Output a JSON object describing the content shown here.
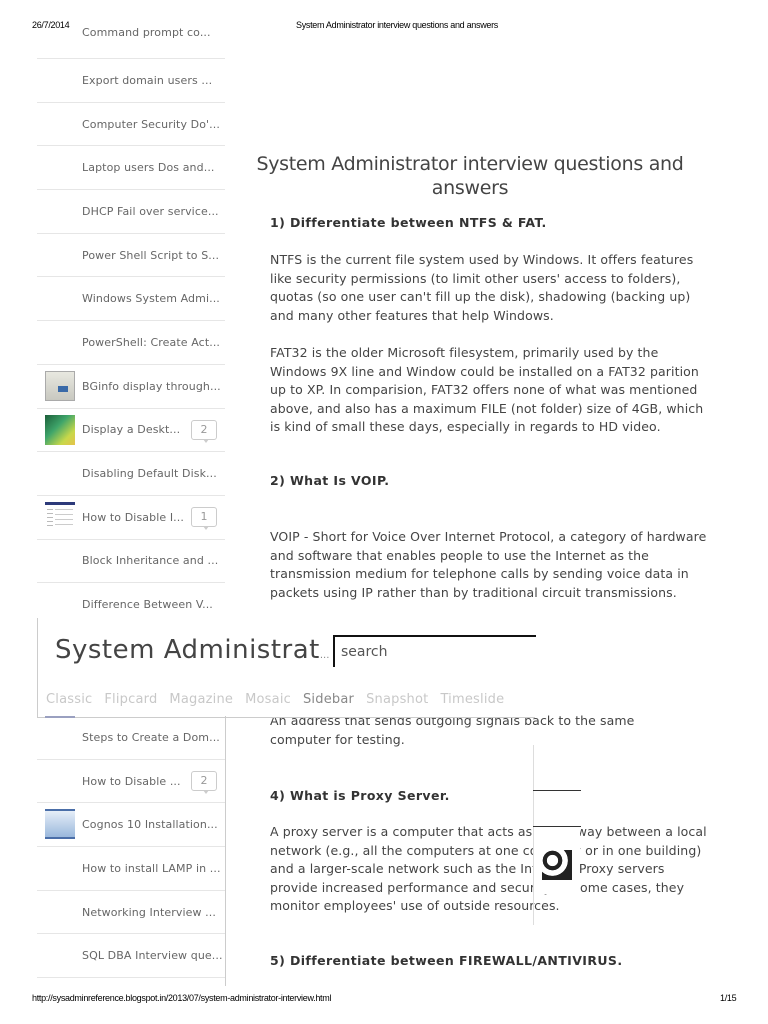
{
  "print_header": {
    "date": "26/7/2014",
    "title": "System Administrator interview questions and answers"
  },
  "print_footer": {
    "url": "http://sysadminreference.blogspot.in/2013/07/system-administrator-interview.html",
    "page": "1/15"
  },
  "sidebar_top": [
    {
      "label": "Command prompt co...",
      "thumb": null,
      "count": null
    },
    {
      "label": "Export domain users ...",
      "thumb": null,
      "count": null
    },
    {
      "label": "Computer Security Do'...",
      "thumb": null,
      "count": null
    },
    {
      "label": "Laptop users Dos and...",
      "thumb": null,
      "count": null
    },
    {
      "label": "DHCP Fail over service...",
      "thumb": null,
      "count": null
    },
    {
      "label": "Power Shell Script to S...",
      "thumb": null,
      "count": null
    },
    {
      "label": "Windows System Admi...",
      "thumb": null,
      "count": null
    },
    {
      "label": "PowerShell: Create Act...",
      "thumb": null,
      "count": null
    },
    {
      "label": "BGinfo display through...",
      "thumb": "bginfo-screenshot",
      "count": null
    },
    {
      "label": "Display a Deskt...",
      "thumb": "desktop-wallpaper",
      "count": "2"
    },
    {
      "label": "Disabling Default Disk...",
      "thumb": null,
      "count": null
    },
    {
      "label": "How to Disable I...",
      "thumb": "settings-screenshot",
      "count": "1"
    },
    {
      "label": "Block Inheritance and ...",
      "thumb": null,
      "count": null
    },
    {
      "label": "Difference Between V...",
      "thumb": null,
      "count": null
    }
  ],
  "sidebar_bottom": [
    {
      "label": "Steps to Create a Dom...",
      "thumb": "steps-screenshot",
      "count": null
    },
    {
      "label": "How to Disable ...",
      "thumb": null,
      "count": "2"
    },
    {
      "label": "Cognos 10 Installation...",
      "thumb": "cognos-screenshot",
      "count": null
    },
    {
      "label": "How to install LAMP in ...",
      "thumb": null,
      "count": null
    },
    {
      "label": "Networking Interview ...",
      "thumb": null,
      "count": null
    },
    {
      "label": "SQL DBA Interview que...",
      "thumb": null,
      "count": null
    }
  ],
  "blog_header": {
    "title": "System Administrat",
    "title_ellipsis": "...",
    "search_placeholder": "search",
    "view_tabs": [
      {
        "label": "Classic",
        "active": false
      },
      {
        "label": "Flipcard",
        "active": false
      },
      {
        "label": "Magazine",
        "active": false
      },
      {
        "label": "Mosaic",
        "active": false
      },
      {
        "label": "Sidebar",
        "active": true
      },
      {
        "label": "Snapshot",
        "active": false
      },
      {
        "label": "Timeslide",
        "active": false
      }
    ]
  },
  "article": {
    "title": "System Administrator interview questions and answers",
    "q1": "1) Differentiate between NTFS & FAT.",
    "q1_p1": "NTFS is the current file system used by Windows. It offers features like security permissions (to limit other users' access to folders), quotas (so one user can't fill up the disk), shadowing (backing up) and many other features that help Windows.",
    "q1_p2": "FAT32 is the older Microsoft filesystem, primarily used by the Windows 9X line and Window could be installed on a FAT32 parition up to XP. In comparision, FAT32 offers none of what was mentioned above, and also has a maximum FILE (not folder) size of 4GB, which is kind of small these days, especially in regards to HD video.",
    "q2": "2) What Is VOIP.",
    "q2_p1": "VOIP - Short for Voice Over Internet Protocol, a category of hardware and software that enables people to use the Internet as the transmission medium for telephone calls by sending voice data in packets using IP rather than by traditional circuit transmissions.",
    "q3_p1": "An address that sends outgoing signals back to the same computer for testing.",
    "q4": "4) What is Proxy Server.",
    "q4_p1": "A proxy server is a computer that acts as a gateway between a local network (e.g., all the computers at one company or in one building) and a larger-scale network such as the Internet. Proxy servers provide increased performance and security. In some cases, they monitor employees' use of outside resources.",
    "q5": "5) Differentiate between FIREWALL/ANTIVIRUS."
  }
}
